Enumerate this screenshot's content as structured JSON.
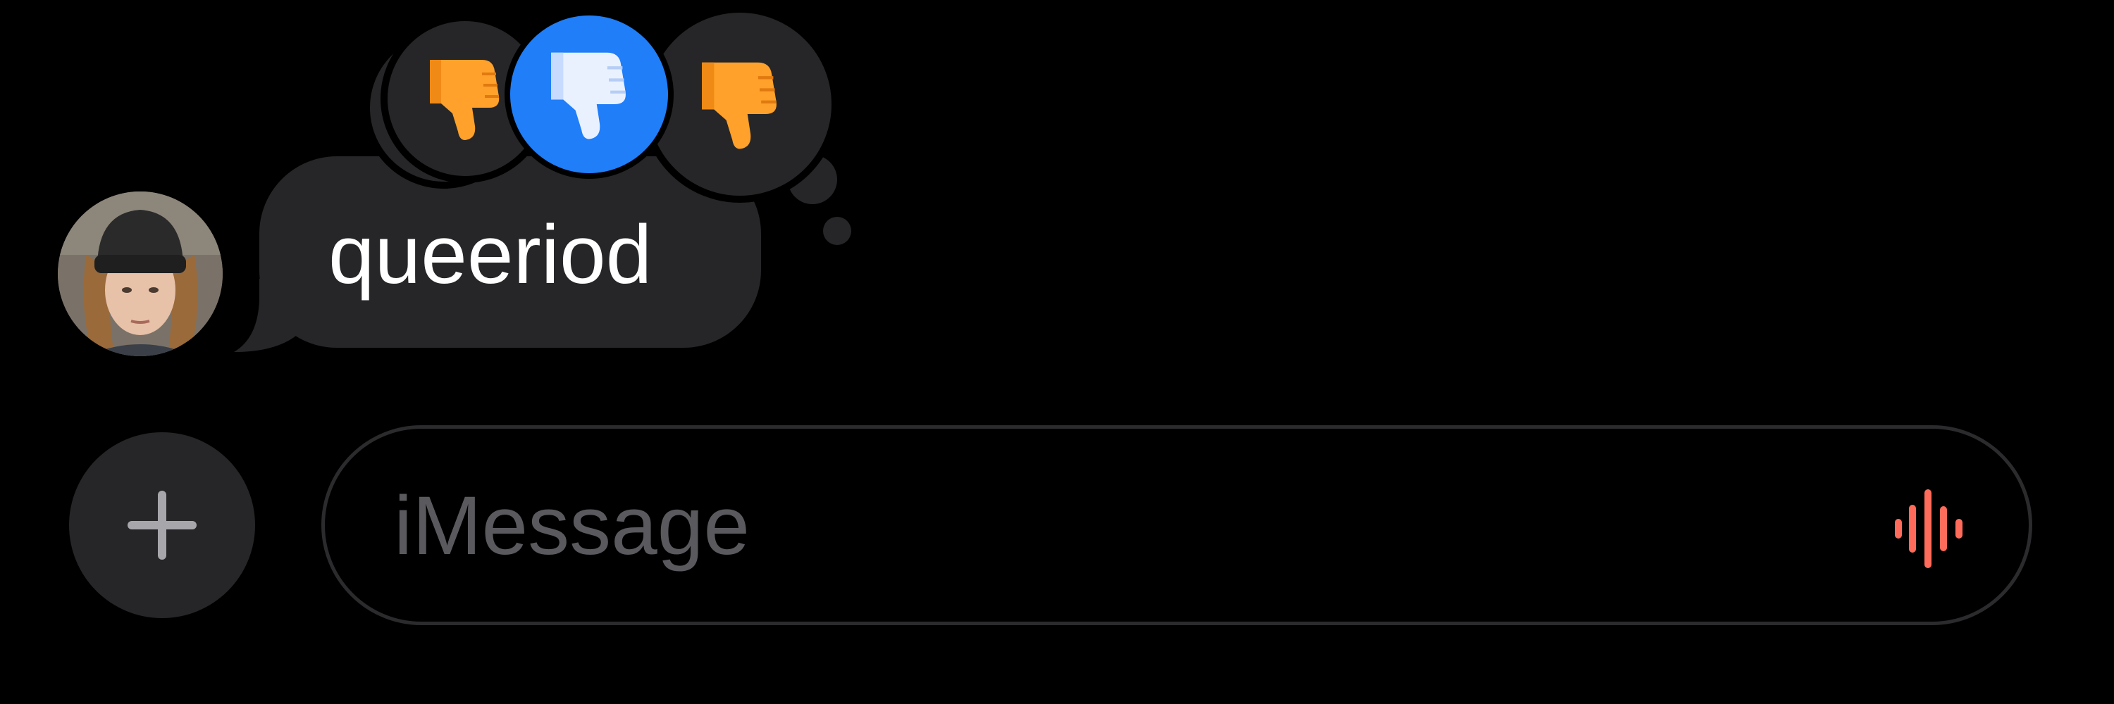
{
  "conversation": {
    "messages": [
      {
        "direction": "received",
        "text": "queeriod",
        "avatar": "contact-avatar-photo",
        "tapbacks": [
          {
            "reaction": "thumbs-down-icon",
            "own": false
          },
          {
            "reaction": "thumbs-down-icon",
            "own": false
          },
          {
            "reaction": "thumbs-down-icon",
            "own": true
          },
          {
            "reaction": "thumbs-down-icon",
            "own": false
          }
        ]
      }
    ]
  },
  "composer": {
    "placeholder": "iMessage",
    "add_icon": "plus-icon",
    "audio_icon": "waveform-icon"
  },
  "colors": {
    "background": "#000000",
    "bubble": "#262628",
    "own_tapback": "#1f7ef8",
    "emoji_orange": "#ffa12a",
    "waveform": "#ff6b5a",
    "placeholder": "#5a5a5e"
  }
}
